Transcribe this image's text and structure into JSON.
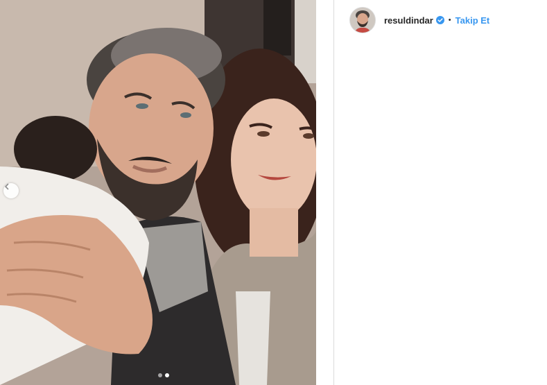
{
  "post": {
    "username": "resuldindar",
    "verified": true,
    "separator": "•",
    "follow_label": "Takip Et",
    "carousel": {
      "slide_count": 2,
      "active_index": 1
    },
    "colors": {
      "follow_blue": "#3897f0",
      "verified_blue": "#3897f0",
      "divider": "#dbdbdb"
    }
  }
}
